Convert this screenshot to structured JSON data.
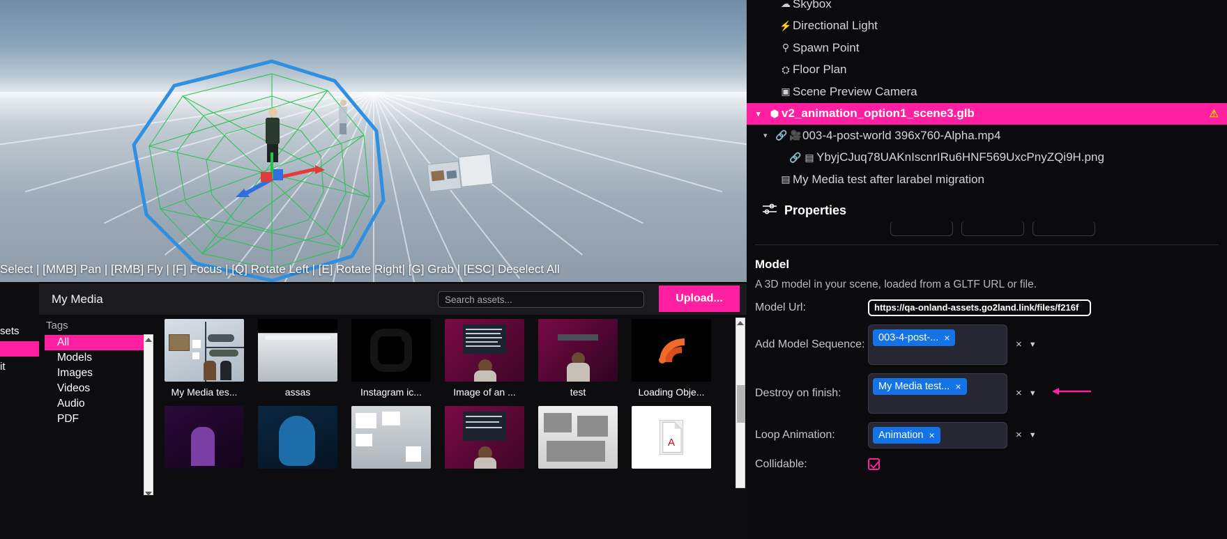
{
  "viewport": {
    "hotbar": "Select | [MMB] Pan | [RMB] Fly | [F] Focus | [Q] Rotate Left | [E] Rotate Right| [G] Grab | [ESC] Deselect All"
  },
  "left_strip": {
    "items": [
      {
        "label": "sets"
      },
      {
        "label": ""
      },
      {
        "label": "it"
      }
    ]
  },
  "media": {
    "title": "My Media",
    "search_placeholder": "Search assets...",
    "search_value": "",
    "upload_label": "Upload...",
    "tags_label": "Tags",
    "tags": [
      {
        "label": "All",
        "active": true
      },
      {
        "label": "Models",
        "active": false
      },
      {
        "label": "Images",
        "active": false
      },
      {
        "label": "Videos",
        "active": false
      },
      {
        "label": "Audio",
        "active": false
      },
      {
        "label": "PDF",
        "active": false
      }
    ],
    "assets_row1": [
      {
        "label": "My Media tes...",
        "art": "t-room"
      },
      {
        "label": "assas",
        "art": "t-assas"
      },
      {
        "label": "Instagram ic...",
        "art": "t-insta"
      },
      {
        "label": "Image of an ...",
        "art": "t-doc"
      },
      {
        "label": "test",
        "art": "t-test"
      },
      {
        "label": "Loading Obje...",
        "art": "t-load"
      }
    ],
    "assets_row2": [
      {
        "label": "",
        "art": "t-purple"
      },
      {
        "label": "",
        "art": "t-blue"
      },
      {
        "label": "",
        "art": "t-office"
      },
      {
        "label": "",
        "art": "t-doc"
      },
      {
        "label": "",
        "art": "t-screens"
      },
      {
        "label": "",
        "art": "t-pdf"
      }
    ]
  },
  "hierarchy": {
    "items": [
      {
        "label": "Skybox",
        "icon": "cloud-icon",
        "indent": 1,
        "caret": "",
        "selected": false,
        "warn": ""
      },
      {
        "label": "Directional Light",
        "icon": "bolt-icon",
        "indent": 1,
        "caret": "",
        "selected": false,
        "warn": ""
      },
      {
        "label": "Spawn Point",
        "icon": "spawn-icon",
        "indent": 1,
        "caret": "",
        "selected": false,
        "warn": ""
      },
      {
        "label": "Floor Plan",
        "icon": "floorplan-icon",
        "indent": 1,
        "caret": "",
        "selected": false,
        "warn": ""
      },
      {
        "label": "Scene Preview Camera",
        "icon": "camera-icon",
        "indent": 1,
        "caret": "",
        "selected": false,
        "warn": ""
      },
      {
        "label": "v2_animation_option1_scene3.glb",
        "icon": "cube-icon",
        "indent": 1,
        "caret": "▾",
        "selected": true,
        "warn": "⚠"
      },
      {
        "label": "003-4-post-world 396x760-Alpha.mp4",
        "icon": "video-icon",
        "indent": 2,
        "caret": "▾",
        "selected": false,
        "warn": ""
      },
      {
        "label": "YbyjCJuq78UAKnIscnrIRu6HNF569UxcPnyZQi9H.png",
        "icon": "image-icon",
        "indent": 3,
        "caret": "",
        "selected": false,
        "warn": ""
      },
      {
        "label": "My Media test after larabel migration",
        "icon": "image-icon",
        "indent": 1,
        "caret": "",
        "selected": false,
        "warn": ""
      }
    ]
  },
  "properties": {
    "header": "Properties",
    "section_title": "Model",
    "section_desc": "A 3D model in your scene, loaded from a GLTF URL or file.",
    "fields": {
      "model_url_label": "Model Url:",
      "model_url_value": "https://qa-onland-assets.go2land.link/files/f216f",
      "add_model_sequence_label": "Add Model Sequence:",
      "add_model_sequence_chip": "003-4-post-...",
      "destroy_on_finish_label": "Destroy on finish:",
      "destroy_on_finish_chip": "My Media test...",
      "loop_animation_label": "Loop Animation:",
      "loop_animation_chip": "Animation",
      "collidable_label": "Collidable:",
      "collidable_checked": true
    }
  },
  "colors": {
    "accent_pink": "#ff1fa0",
    "chip_blue": "#1473e6",
    "warn_yellow": "#ffd400"
  }
}
